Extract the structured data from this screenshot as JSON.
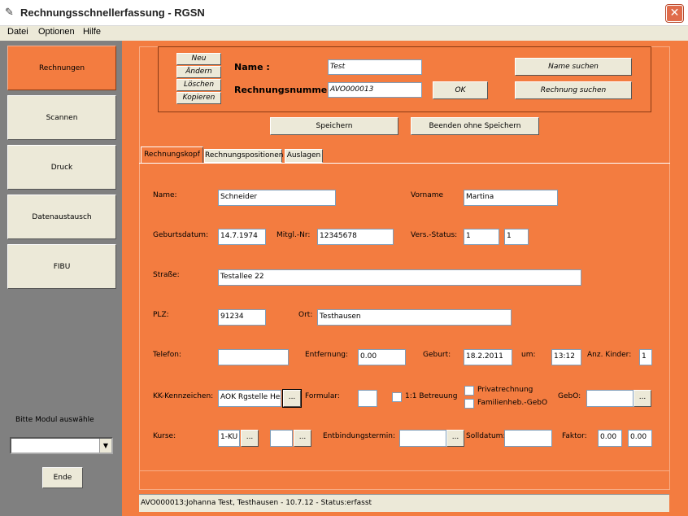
{
  "window": {
    "title": "Rechnungsschnellerfassung - RGSN",
    "close_label": "✕"
  },
  "menu": [
    "Datei",
    "Optionen",
    "Hilfe"
  ],
  "sidebar": {
    "items": [
      {
        "label": "Rechnungen",
        "active": true
      },
      {
        "label": "Scannen",
        "active": false
      },
      {
        "label": "Druck",
        "active": false
      },
      {
        "label": "Datenaustausch",
        "active": false
      },
      {
        "label": "FIBU",
        "active": false
      }
    ],
    "module_label": "Bitte Modul auswähle",
    "module_value": "",
    "exit_label": "Ende"
  },
  "header": {
    "actions": [
      "Neu",
      "Ändern",
      "Löschen",
      "Kopieren"
    ],
    "name_label": "Name :",
    "name_value": "Test",
    "invoice_label": "Rechnungsnummer :",
    "invoice_value": "AVO000013",
    "ok_label": "OK",
    "search_name_label": "Name suchen",
    "search_invoice_label": "Rechnung suchen",
    "save_label": "Speichern",
    "exit_nosave_label": "Beenden ohne Speichern"
  },
  "tabs": [
    "Rechnungskopf",
    "Rechnungspositionen",
    "Auslagen"
  ],
  "form": {
    "name_label": "Name:",
    "name": "Schneider",
    "vorname_label": "Vorname",
    "vorname": "Martina",
    "geburtsdatum_label": "Geburtsdatum:",
    "geburtsdatum": "14.7.1974",
    "mitgl_label": "Mitgl.-Nr:",
    "mitgl": "12345678",
    "vers_label": "Vers.-Status:",
    "vers1": "1",
    "vers2": "1",
    "strasse_label": "Straße:",
    "strasse": "Testallee 22",
    "plz_label": "PLZ:",
    "plz": "91234",
    "ort_label": "Ort:",
    "ort": "Testhausen",
    "telefon_label": "Telefon:",
    "telefon": "",
    "entfernung_label": "Entfernung:",
    "entfernung": "0.00",
    "geburt_label": "Geburt:",
    "geburt": "18.2.2011",
    "um_label": "um:",
    "um": "13:12",
    "kinder_label": "Anz. Kinder:",
    "kinder": "1",
    "kk_label": "KK-Kennzeichen:",
    "kk": "AOK Rgstelle Hes",
    "formular_label": "Formular:",
    "formular": "",
    "betreuung_label": "1:1 Betreuung",
    "privat_label": "Privatrechnung",
    "familien_label": "Familienheb.-GebO",
    "gebo_label": "GebO:",
    "gebo": "",
    "kurse_label": "Kurse:",
    "kurse1": "1-KU",
    "kurse2": "",
    "entbindung_label": "Entbindungstermin:",
    "entbindung": "",
    "soll_label": "Solldatum:",
    "soll": "",
    "faktor_label": "Faktor:",
    "faktor1": "0.00",
    "faktor2": "0.00",
    "ellipsis": "..."
  },
  "status": "AVO000013:Johanna Test, Testhausen - 10.7.12 - Status:erfasst"
}
